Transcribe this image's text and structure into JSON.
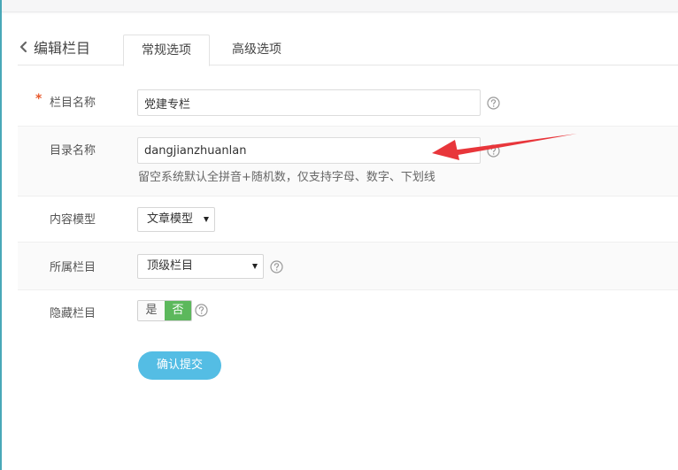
{
  "header": {
    "title": "编辑栏目"
  },
  "tabs": [
    {
      "label": "常规选项",
      "active": true
    },
    {
      "label": "高级选项",
      "active": false
    }
  ],
  "form": {
    "name": {
      "label": "栏目名称",
      "required_mark": "*",
      "value": "党建专栏"
    },
    "dir": {
      "label": "目录名称",
      "value": "dangjianzhuanlan",
      "hint": "留空系统默认全拼音+随机数，仅支持字母、数字、下划线"
    },
    "model": {
      "label": "内容模型",
      "selected": "文章模型"
    },
    "parent": {
      "label": "所属栏目",
      "selected": "顶级栏目"
    },
    "hidden": {
      "label": "隐藏栏目",
      "yes_label": "是",
      "no_label": "否",
      "selected": "否"
    },
    "submit_label": "确认提交"
  },
  "colors": {
    "accent_blue": "#54bde4",
    "toggle_green": "#5cb85c",
    "required_orange": "#e8592c",
    "annotation_red": "#e8363b",
    "left_rule": "#49a8b8"
  },
  "icons": [
    "chevron-left-icon",
    "help-circle-icon",
    "caret-down-icon"
  ]
}
